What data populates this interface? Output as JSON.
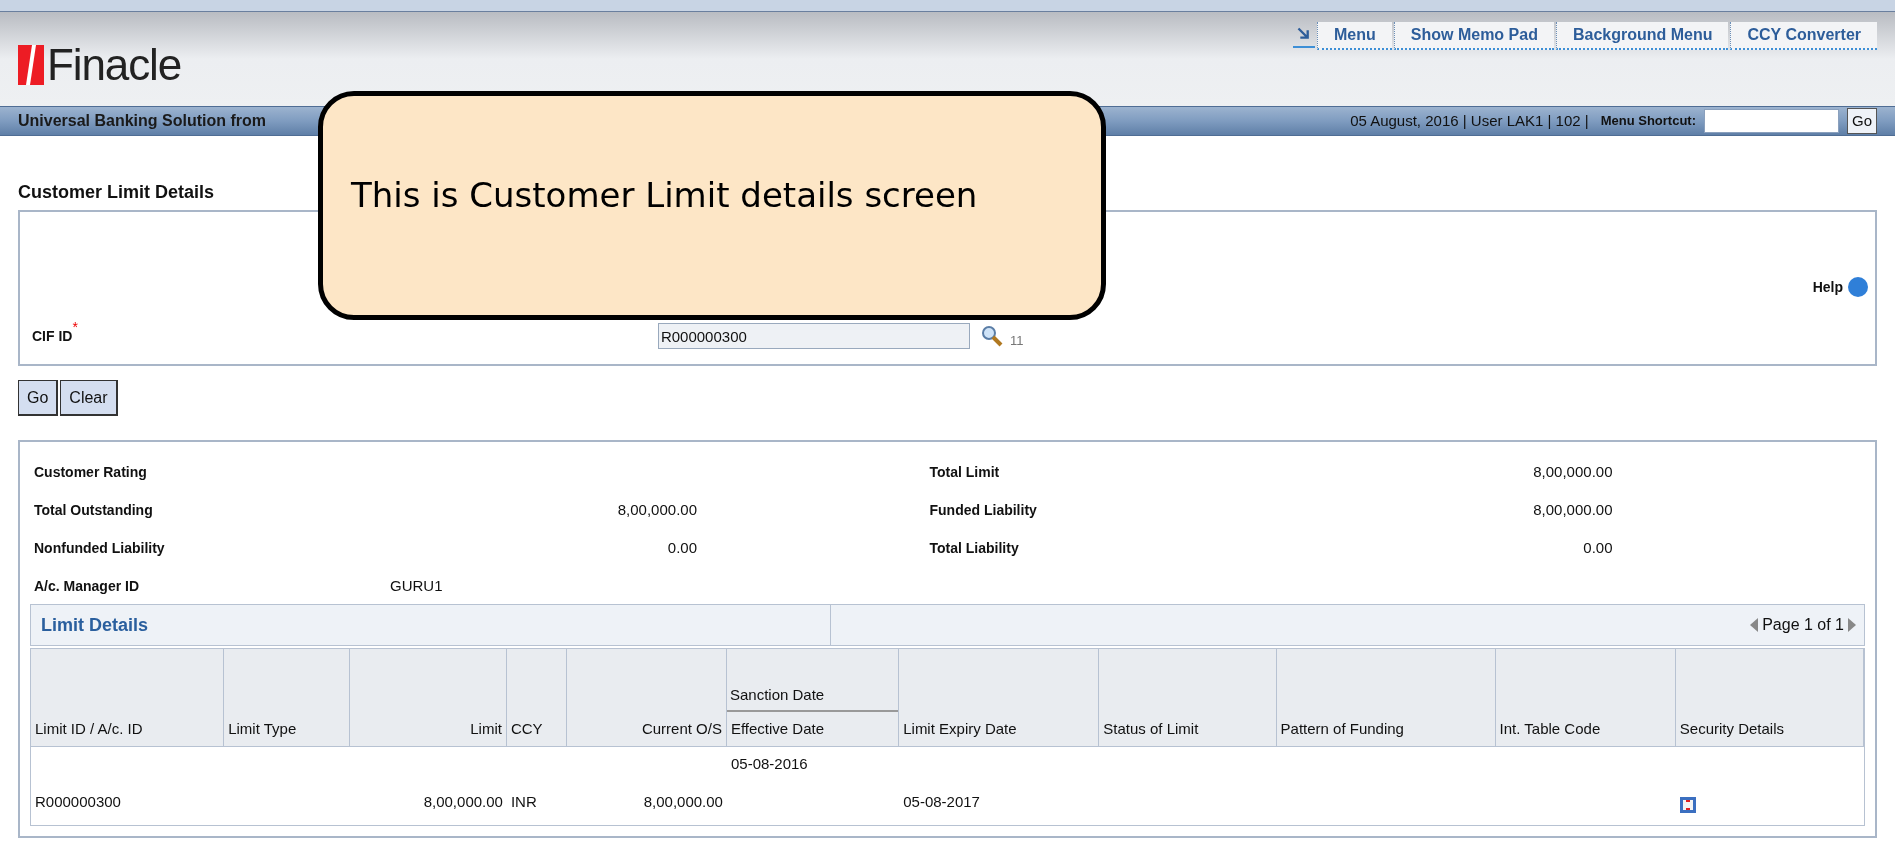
{
  "header": {
    "logo": "Finacle",
    "menu_links": [
      "Menu",
      "Show Memo Pad",
      "Background Menu",
      "CCY Converter"
    ],
    "tagline": "Universal Banking Solution from",
    "session": "05 August, 2016 | User LAK1 | 102 |",
    "shortcut_label": "Menu Shortcut:",
    "shortcut_button": "Go"
  },
  "page_title": "Customer Limit Details",
  "search": {
    "help": "Help",
    "field_label": "CIF ID",
    "required_mark": "*",
    "value": "R000000300",
    "count": "11"
  },
  "buttons": [
    "Go",
    "Clear"
  ],
  "summary": [
    {
      "label": "Customer Rating",
      "kind": "amount"
    },
    {
      "label": "Total Limit",
      "value": "8,00,000.00",
      "kind": "amount"
    },
    {
      "label": "Total Outstanding",
      "value": "8,00,000.00",
      "kind": "amount"
    },
    {
      "label": "Funded Liability",
      "value": "8,00,000.00",
      "kind": "amount"
    },
    {
      "label": "Nonfunded Liability",
      "value": "0.00",
      "kind": "amount"
    },
    {
      "label": "Total Liability",
      "value": "0.00",
      "kind": "amount"
    },
    {
      "label": "A/c. Manager ID",
      "value": "GURU1",
      "kind": "text"
    }
  ],
  "limit_details": {
    "title": "Limit Details",
    "pager": "Page 1 of 1",
    "columns": [
      {
        "label": "Limit ID / A/c. ID",
        "kind": "text"
      },
      {
        "label": "Limit Type",
        "kind": "text"
      },
      {
        "label": "Limit",
        "kind": "amount"
      },
      {
        "label": "CCY",
        "kind": "text"
      },
      {
        "label": "Current O/S",
        "kind": "amount"
      },
      {
        "label": "Effective Date",
        "group": "Sanction Date",
        "kind": "text"
      },
      {
        "label": "Limit Expiry Date",
        "kind": "text"
      },
      {
        "label": "Status of Limit",
        "kind": "text"
      },
      {
        "label": "Pattern of Funding",
        "kind": "text"
      },
      {
        "label": "Int. Table Code",
        "kind": "text"
      },
      {
        "label": "Security Details",
        "kind": "icon"
      }
    ],
    "rows": [
      {
        "limit_id": "R000000300",
        "limit": "8,00,000.00",
        "ccy": "INR",
        "current_os": "8,00,000.00",
        "sanction_date": "05-08-2016",
        "limit_expiry_date": "05-08-2017"
      }
    ]
  },
  "callout": {
    "text": "This is Customer Limit details screen"
  }
}
